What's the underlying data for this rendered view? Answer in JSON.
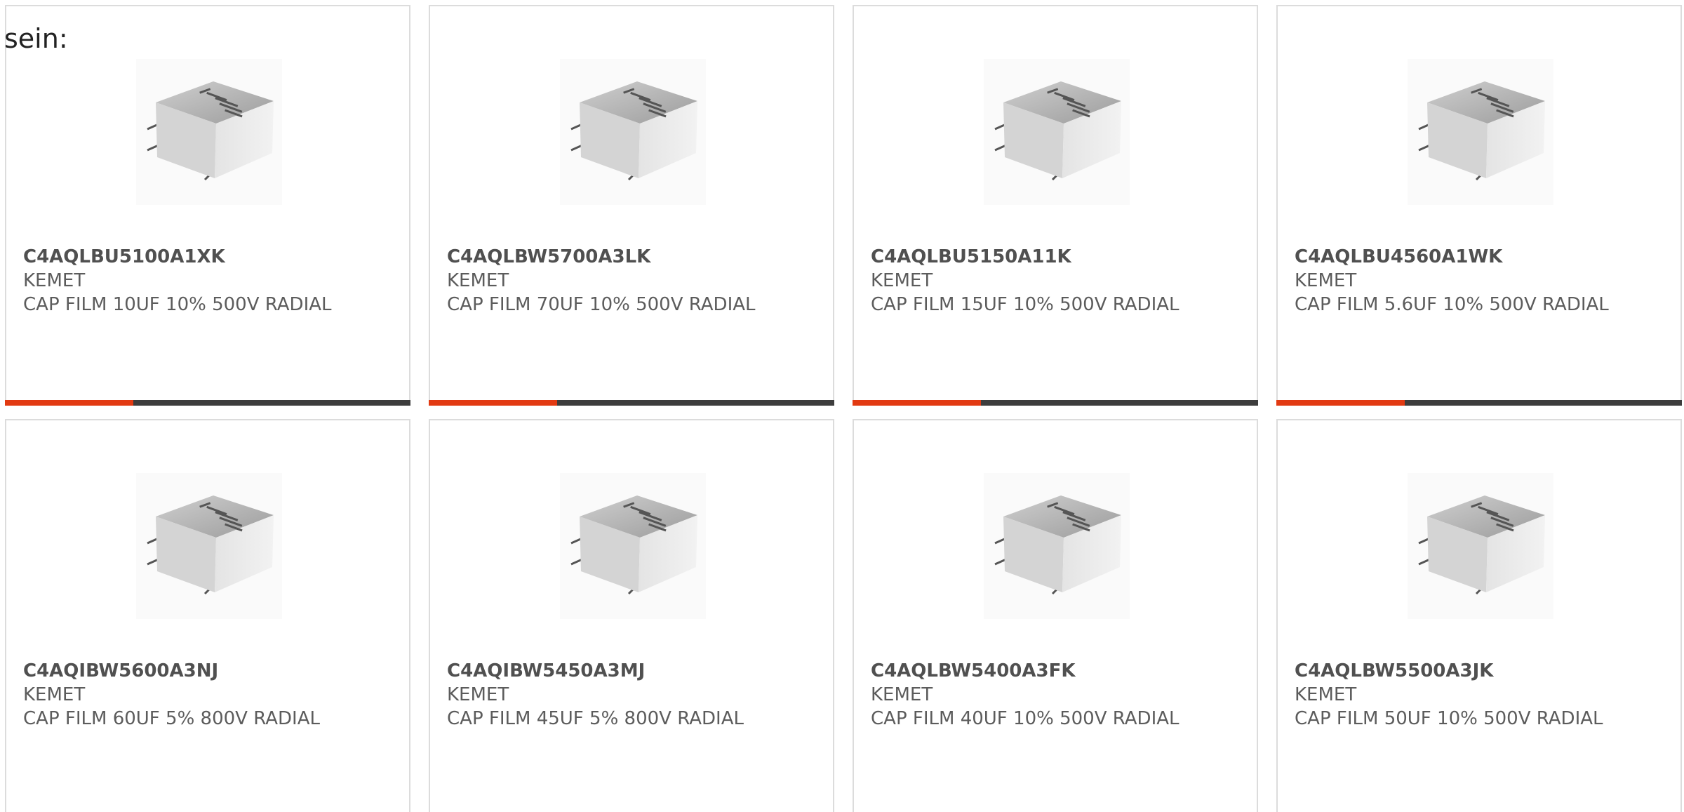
{
  "intro": {
    "text": "sein:"
  },
  "colors": {
    "accent": "#e23a12",
    "bar": "#3d3d3d",
    "border": "#dcdcdc",
    "text": "#5c5c5c"
  },
  "products": [
    {
      "part_number": "C4AQLBU5100A1XK",
      "manufacturer": "KEMET",
      "description": "CAP FILM 10UF 10% 500V RADIAL",
      "image_icon": "film-capacitor-icon"
    },
    {
      "part_number": "C4AQLBW5700A3LK",
      "manufacturer": "KEMET",
      "description": "CAP FILM 70UF 10% 500V RADIAL",
      "image_icon": "film-capacitor-icon"
    },
    {
      "part_number": "C4AQLBU5150A11K",
      "manufacturer": "KEMET",
      "description": "CAP FILM 15UF 10% 500V RADIAL",
      "image_icon": "film-capacitor-icon"
    },
    {
      "part_number": "C4AQLBU4560A1WK",
      "manufacturer": "KEMET",
      "description": "CAP FILM 5.6UF 10% 500V RADIAL",
      "image_icon": "film-capacitor-icon"
    },
    {
      "part_number": "C4AQIBW5600A3NJ",
      "manufacturer": "KEMET",
      "description": "CAP FILM 60UF 5% 800V RADIAL",
      "image_icon": "film-capacitor-icon"
    },
    {
      "part_number": "C4AQIBW5450A3MJ",
      "manufacturer": "KEMET",
      "description": "CAP FILM 45UF 5% 800V RADIAL",
      "image_icon": "film-capacitor-icon"
    },
    {
      "part_number": "C4AQLBW5400A3FK",
      "manufacturer": "KEMET",
      "description": "CAP FILM 40UF 10% 500V RADIAL",
      "image_icon": "film-capacitor-icon"
    },
    {
      "part_number": "C4AQLBW5500A3JK",
      "manufacturer": "KEMET",
      "description": "CAP FILM 50UF 10% 500V RADIAL",
      "image_icon": "film-capacitor-icon"
    }
  ]
}
